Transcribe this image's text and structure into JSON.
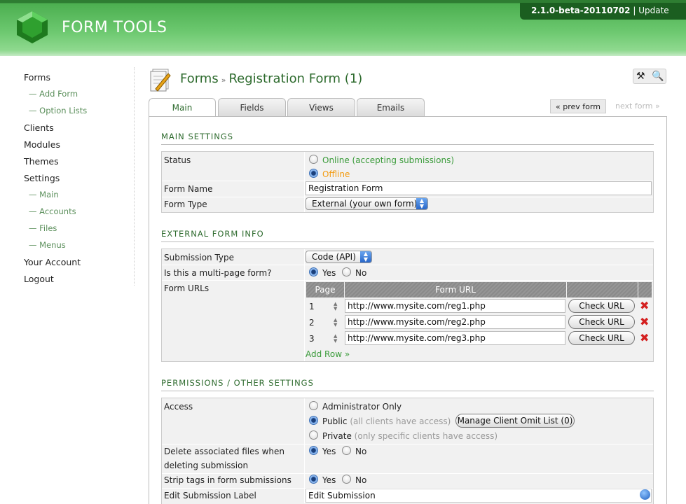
{
  "header": {
    "logo_text": "FORM TOOLS",
    "version": "2.1.0-beta-20110702",
    "divider": "|",
    "update_label": "Update"
  },
  "sidebar": {
    "items": [
      {
        "label": "Forms",
        "sub": false
      },
      {
        "label": "— Add Form",
        "sub": true
      },
      {
        "label": "— Option Lists",
        "sub": true
      },
      {
        "label": "Clients",
        "sub": false
      },
      {
        "label": "Modules",
        "sub": false
      },
      {
        "label": "Themes",
        "sub": false
      },
      {
        "label": "Settings",
        "sub": false
      },
      {
        "label": "— Main",
        "sub": true
      },
      {
        "label": "— Accounts",
        "sub": true
      },
      {
        "label": "— Files",
        "sub": true
      },
      {
        "label": "— Menus",
        "sub": true
      },
      {
        "label": "Your Account",
        "sub": false
      },
      {
        "label": "Logout",
        "sub": false
      }
    ]
  },
  "title": {
    "section": "Forms",
    "separator": "»",
    "form_name": "Registration Form (1)"
  },
  "tabs": [
    "Main",
    "Fields",
    "Views",
    "Emails"
  ],
  "nav": {
    "prev": "« prev form",
    "next": "next form »"
  },
  "main_settings": {
    "title": "MAIN SETTINGS",
    "status_label": "Status",
    "status_online": "Online (accepting submissions)",
    "status_offline": "Offline",
    "status_selected": "Offline",
    "form_name_label": "Form Name",
    "form_name_value": "Registration Form",
    "form_type_label": "Form Type",
    "form_type_value": "External (your own form)"
  },
  "external_info": {
    "title": "EXTERNAL FORM INFO",
    "submission_type_label": "Submission Type",
    "submission_type_value": "Code (API)",
    "multipage_label": "Is this a multi-page form?",
    "yes": "Yes",
    "no": "No",
    "multipage_selected": "Yes",
    "form_urls_label": "Form URLs",
    "col_page": "Page",
    "col_url": "Form URL",
    "check_url_label": "Check URL",
    "delete_glyph": "✖",
    "rows": [
      {
        "page": "1",
        "url": "http://www.mysite.com/reg1.php"
      },
      {
        "page": "2",
        "url": "http://www.mysite.com/reg2.php"
      },
      {
        "page": "3",
        "url": "http://www.mysite.com/reg3.php"
      }
    ],
    "add_row": "Add Row »"
  },
  "permissions": {
    "title": "PERMISSIONS / OTHER SETTINGS",
    "access_label": "Access",
    "access_admin": "Administrator Only",
    "access_public": "Public",
    "access_public_note": "(all clients have access)",
    "access_private": "Private",
    "access_private_note": "(only specific clients have access)",
    "access_selected": "Public",
    "omit_list_button": "Manage Client Omit List (0)",
    "delete_files_label_1": "Delete associated files when",
    "delete_files_label_2": "deleting submission",
    "delete_files_selected": "Yes",
    "strip_tags_label": "Strip tags in form submissions",
    "strip_tags_selected": "Yes",
    "edit_label_label": "Edit Submission Label",
    "edit_label_value": "Edit Submission",
    "yes": "Yes",
    "no": "No"
  },
  "colors": {
    "brand_green": "#4caf50",
    "title_green": "#2e6b2e",
    "delete_red": "#d42020"
  }
}
